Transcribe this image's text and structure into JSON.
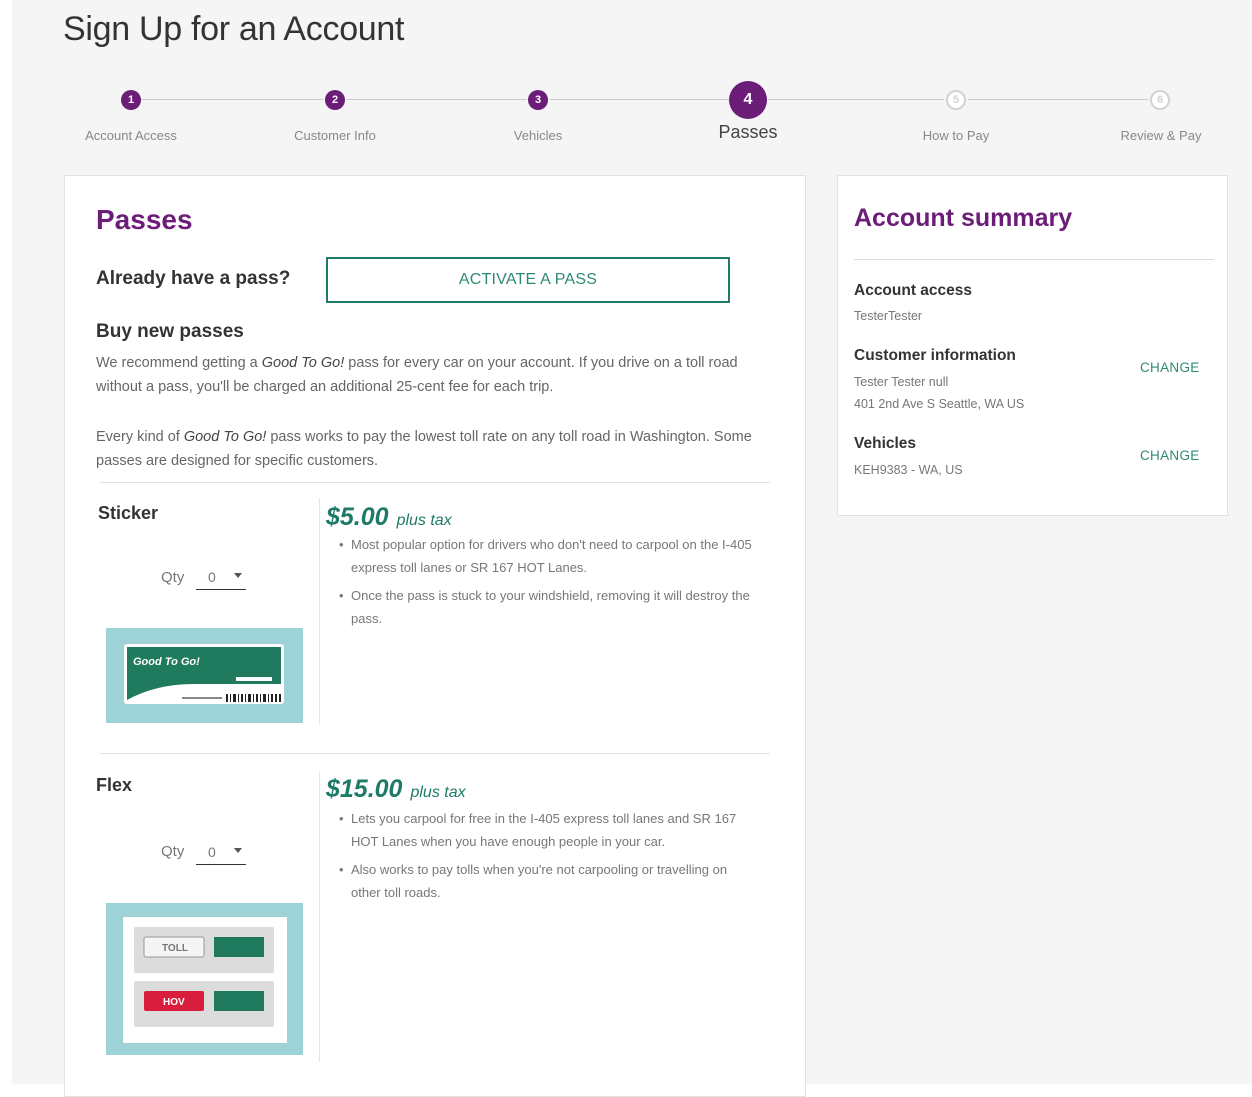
{
  "page": {
    "title": "Sign Up for an Account"
  },
  "stepper": {
    "steps": [
      {
        "number": "1",
        "label": "Account Access",
        "state": "done"
      },
      {
        "number": "2",
        "label": "Customer Info",
        "state": "done"
      },
      {
        "number": "3",
        "label": "Vehicles",
        "state": "done"
      },
      {
        "number": "4",
        "label": "Passes",
        "state": "active"
      },
      {
        "number": "5",
        "label": "How to Pay",
        "state": "upcoming"
      },
      {
        "number": "6",
        "label": "Review & Pay",
        "state": "upcoming"
      }
    ]
  },
  "passes": {
    "title": "Passes",
    "already_label": "Already have a pass?",
    "activate_button": "ACTIVATE A PASS",
    "buy_heading": "Buy new passes",
    "para1_pre": "We recommend getting a ",
    "brand": "Good To Go!",
    "para1_post": " pass for every car on your account. If you drive on a toll road without a pass, you'll be charged an additional 25-cent fee for each trip.",
    "para2_pre": "Every kind of ",
    "para2_post": " pass works to pay the lowest toll rate on any toll road in Washington. Some passes are designed for specific customers.",
    "qty_label": "Qty",
    "items": [
      {
        "name": "Sticker",
        "qty": "0",
        "price": "$5.00",
        "price_suffix": "plus tax",
        "bullets": [
          "Most popular option for drivers who don't need to carpool on the I-405 express toll lanes or SR 167 HOT Lanes.",
          "Once the pass is stuck to your windshield, removing it will destroy the pass."
        ]
      },
      {
        "name": "Flex",
        "qty": "0",
        "price": "$15.00",
        "price_suffix": "plus tax",
        "bullets": [
          "Lets you carpool for free in the I-405 express toll lanes and SR 167 HOT Lanes when you have enough people in your car.",
          "Also works to pay tolls when you're not carpooling or travelling on other toll roads."
        ]
      }
    ],
    "sticker_img_text": "Good To Go!",
    "flex_img_toll": "TOLL",
    "flex_img_hov": "HOV"
  },
  "summary": {
    "title": "Account summary",
    "account_access_label": "Account access",
    "account_access_value": "TesterTester",
    "customer_label": "Customer information",
    "customer_line1": "Tester Tester null",
    "customer_line2": "401 2nd Ave S Seattle, WA US",
    "vehicles_label": "Vehicles",
    "vehicles_value": "KEH9383 - WA, US",
    "change_label": "CHANGE"
  },
  "colors": {
    "brand_purple": "#6b1d78",
    "brand_green": "#1f7a67",
    "pass_bg": "#9dd3d7"
  }
}
